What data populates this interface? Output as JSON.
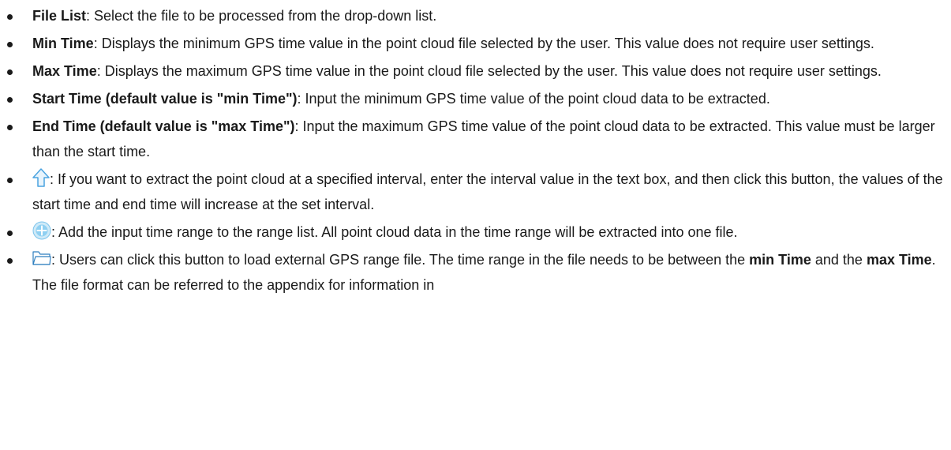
{
  "items": [
    {
      "term": "File List",
      "text": ": Select the file to be processed from the drop-down list."
    },
    {
      "term": "Min Time",
      "text": ": Displays the minimum GPS time value in the point cloud file selected by the user. This value does not require user settings."
    },
    {
      "term": "Max Time",
      "text": ": Displays the maximum GPS time value in the point cloud file selected by the user. This value does not require user settings."
    },
    {
      "term": "Start Time (default value is \"min Time\")",
      "text": ": Input the minimum GPS time value of the point cloud data to be extracted."
    },
    {
      "term": "End Time (default value is \"max Time\")",
      "text": ": Input the maximum GPS time value of the point cloud data to be extracted. This value must be larger than the start time."
    },
    {
      "icon": "arrow-up-icon",
      "text": ": If you want to extract the point cloud at a specified interval, enter the interval value in the text box, and then click this button, the values of the start time and end time will increase at the set interval."
    },
    {
      "icon": "add-circle-icon",
      "text": ": Add the input time range to the range list. All point cloud data in the time range will be extracted into one file."
    },
    {
      "icon": "folder-icon",
      "text_a": ": Users can click this button to load external GPS range file. The time range in the file needs to be between the ",
      "bold_a": "min Time",
      "text_b": " and the ",
      "bold_b": "max Time",
      "text_c": ". The file format can be referred to the appendix for information in"
    }
  ],
  "colors": {
    "text": "#1a1a1a",
    "arrow_icon": "#4aa3e0",
    "add_icon": "#58b6e6",
    "folder_icon": "#2f7fbf"
  }
}
